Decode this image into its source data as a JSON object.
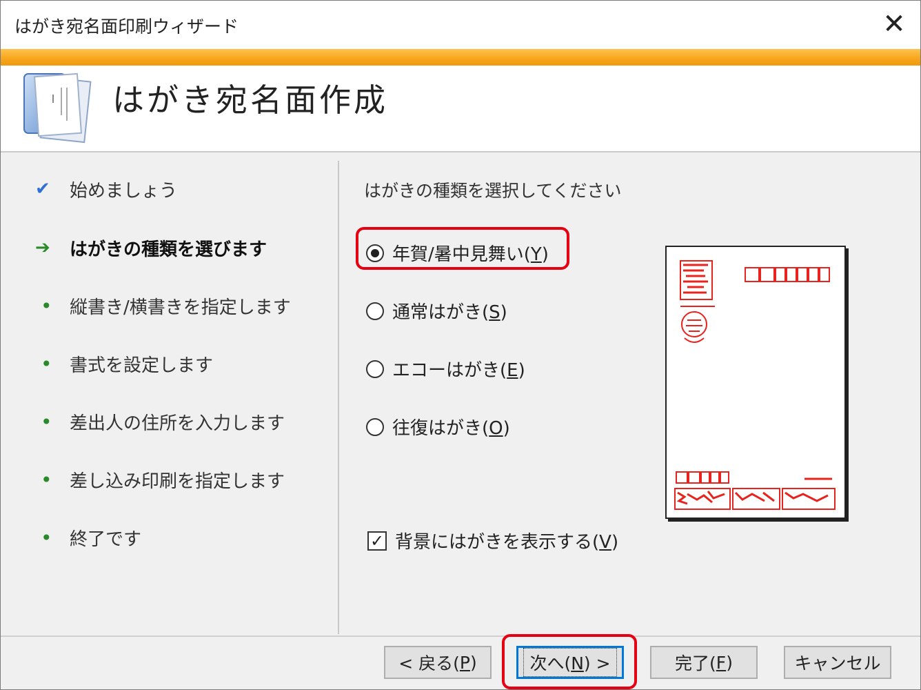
{
  "window": {
    "title": "はがき宛名面印刷ウィザード",
    "close_glyph": "✕"
  },
  "header": {
    "title": "はがき宛名面作成",
    "icon": "postcard-wizard-icon"
  },
  "nav": {
    "items": [
      {
        "label": "始めましょう",
        "state": "done",
        "icon": "check-icon"
      },
      {
        "label": "はがきの種類を選びます",
        "state": "current",
        "icon": "arrow-right-icon"
      },
      {
        "label": "縦書き/横書きを指定します",
        "state": "pending",
        "icon": "bullet-icon"
      },
      {
        "label": "書式を設定します",
        "state": "pending",
        "icon": "bullet-icon"
      },
      {
        "label": "差出人の住所を入力します",
        "state": "pending",
        "icon": "bullet-icon"
      },
      {
        "label": "差し込み印刷を指定します",
        "state": "pending",
        "icon": "bullet-icon"
      },
      {
        "label": "終了です",
        "state": "pending",
        "icon": "bullet-icon"
      }
    ]
  },
  "content": {
    "prompt": "はがきの種類を選択してください",
    "options": [
      {
        "text": "年賀/暑中見舞い(",
        "mnemonic": "Y",
        "close": ")",
        "checked": true
      },
      {
        "text": "通常はがき(",
        "mnemonic": "S",
        "close": ")",
        "checked": false
      },
      {
        "text": "エコーはがき(",
        "mnemonic": "E",
        "close": ")",
        "checked": false
      },
      {
        "text": "往復はがき(",
        "mnemonic": "O",
        "close": ")",
        "checked": false
      }
    ],
    "background_checkbox": {
      "text": "背景にはがきを表示する(",
      "mnemonic": "V",
      "close": ")",
      "checked": true,
      "check_glyph": "✓"
    }
  },
  "buttons": {
    "back": {
      "prefix": "< 戻る(",
      "mnemonic": "P",
      "suffix": ")"
    },
    "next": {
      "prefix": "次へ(",
      "mnemonic": "N",
      "suffix": ") >"
    },
    "finish": {
      "prefix": "完了(",
      "mnemonic": "F",
      "suffix": ")"
    },
    "cancel": {
      "label": "キャンセル"
    }
  },
  "colors": {
    "accent_orange": "#f7a51a",
    "highlight_red": "#e50012",
    "postcard_red": "#e8221c",
    "nav_green": "#2a8a2a",
    "check_blue": "#2f6fd6"
  }
}
